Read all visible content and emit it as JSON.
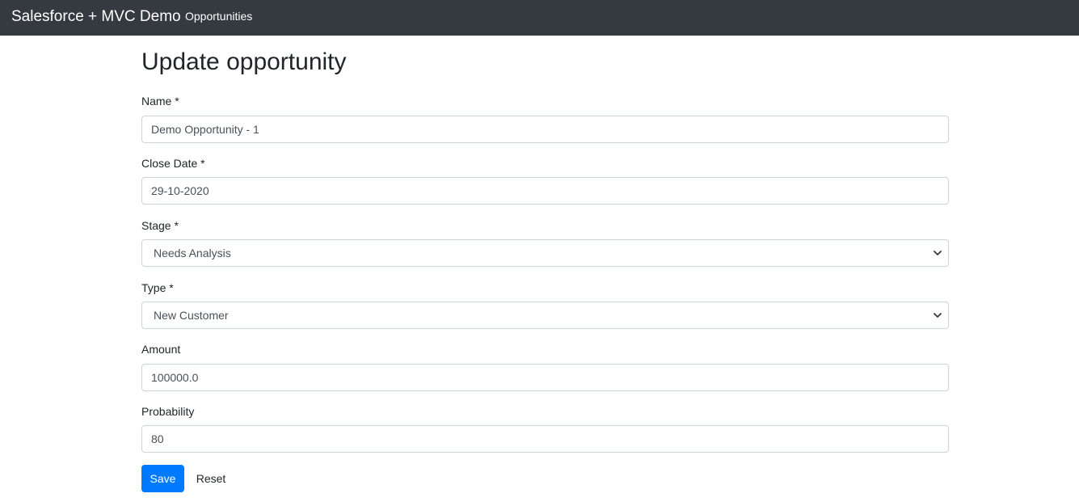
{
  "navbar": {
    "brand": "Salesforce + MVC Demo",
    "links": [
      "Opportunities"
    ]
  },
  "page": {
    "title": "Update opportunity"
  },
  "form": {
    "name": {
      "label": "Name *",
      "value": "Demo Opportunity - 1"
    },
    "close_date": {
      "label": "Close Date *",
      "value": "29-10-2020"
    },
    "stage": {
      "label": "Stage *",
      "value": "Needs Analysis"
    },
    "type": {
      "label": "Type *",
      "value": "New Customer"
    },
    "amount": {
      "label": "Amount",
      "value": "100000.0"
    },
    "probability": {
      "label": "Probability",
      "value": "80"
    },
    "save_label": "Save",
    "reset_label": "Reset"
  },
  "colors": {
    "navbar_bg": "#343a40",
    "primary": "#007bff",
    "input_border": "#ced4da",
    "input_text": "#495057"
  },
  "icons": {
    "select_arrow": "chevron-down-icon"
  }
}
